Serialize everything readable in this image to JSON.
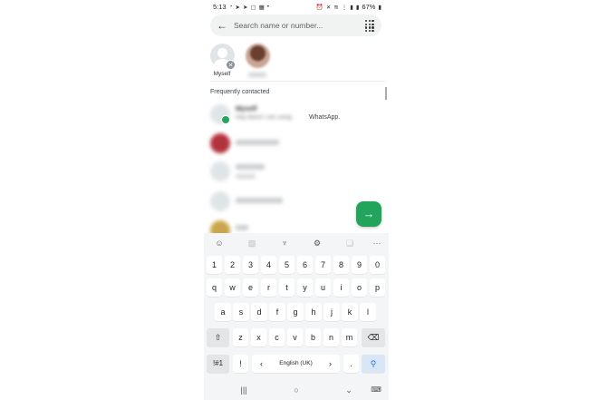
{
  "status_bar": {
    "time": "5:13",
    "left_icons": [
      "whatsapp-status-icon",
      "telegram-icon",
      "telegram-icon",
      "instagram-icon",
      "calendar-icon",
      "dot-icon"
    ],
    "right_icons": [
      "alarm-icon",
      "mute-icon",
      "wifi-icon",
      "volte-icon",
      "signal-icon",
      "signal-icon"
    ],
    "battery": "67%"
  },
  "search": {
    "placeholder": "Search name or number...",
    "back_icon": "back-arrow-icon",
    "dialpad_icon": "dialpad-icon"
  },
  "selected": [
    {
      "label": "Myself",
      "avatar": "default-avatar-icon",
      "remove_icon": "close-icon"
    },
    {
      "label": "",
      "avatar": "photo-avatar"
    }
  ],
  "section_title": "Frequently contacted",
  "contacts": [
    {
      "name": "Myself",
      "status": "Hey there! I am using ",
      "status_clear": "WhatsApp.",
      "avatar_color": "#dfe5e7",
      "selected": true
    },
    {
      "name": "",
      "status": "",
      "avatar_color": "#b3323c",
      "selected": false
    },
    {
      "name": "",
      "status": "",
      "avatar_color": "#dfe5e7",
      "selected": false
    },
    {
      "name": "",
      "status": "",
      "avatar_color": "#dfe5e7",
      "selected": false
    },
    {
      "name": "",
      "status": "",
      "avatar_color": "#c9a64b",
      "selected": false
    }
  ],
  "fab_icon": "arrow-right-icon",
  "keyboard": {
    "toolbar": [
      "emoji-icon",
      "sticker-icon",
      "mic-icon",
      "settings-icon",
      "clipboard-icon",
      "more-icon"
    ],
    "rows": [
      [
        "1",
        "2",
        "3",
        "4",
        "5",
        "6",
        "7",
        "8",
        "9",
        "0"
      ],
      [
        "q",
        "w",
        "e",
        "r",
        "t",
        "y",
        "u",
        "i",
        "o",
        "p"
      ],
      [
        "a",
        "s",
        "d",
        "f",
        "g",
        "h",
        "j",
        "k",
        "l"
      ],
      [
        "z",
        "x",
        "c",
        "v",
        "b",
        "n",
        "m"
      ]
    ],
    "symbols_key": "!#1",
    "comma_key": ",",
    "exclamation_key": "!",
    "left_arrow": "‹",
    "right_arrow": "›",
    "space_label": "English (UK)",
    "period_key": ".",
    "accent_color": "#1a73e8"
  },
  "nav": [
    "recent-apps-icon",
    "home-icon",
    "back-icon",
    "keyboard-hide-icon"
  ],
  "colors": {
    "fab": "#22a45d",
    "search_bg": "#f1f3f3"
  }
}
